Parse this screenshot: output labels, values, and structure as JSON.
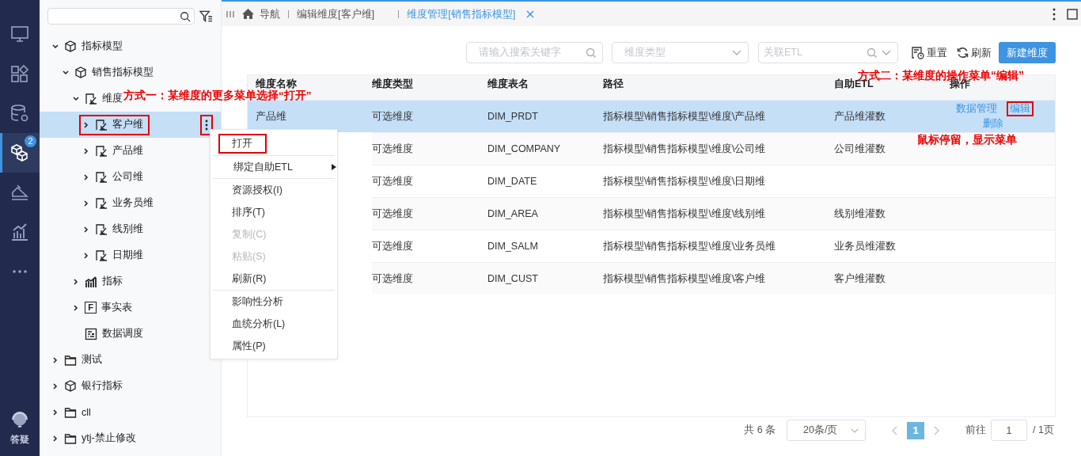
{
  "rail": {
    "items": [
      {
        "kind": "monitor",
        "selected": false
      },
      {
        "kind": "apps",
        "selected": false
      },
      {
        "kind": "database",
        "selected": false
      },
      {
        "kind": "cubes",
        "selected": true,
        "badge": "2"
      },
      {
        "kind": "ramp",
        "selected": false
      },
      {
        "kind": "bars",
        "selected": false
      },
      {
        "kind": "more",
        "selected": false
      }
    ],
    "help": {
      "label": "答疑"
    }
  },
  "sidebar": {
    "tree": [
      {
        "label": "指标模型",
        "kind": "cube",
        "expanded": true,
        "selected": false,
        "children": [
          {
            "label": "销售指标模型",
            "kind": "cube",
            "expanded": true,
            "selected": false,
            "children": [
              {
                "label": "维度",
                "kind": "dim",
                "expanded": true,
                "selected": false,
                "children": [
                  {
                    "label": "客户维",
                    "kind": "dim",
                    "expanded": false,
                    "selected": true,
                    "highlighted": true,
                    "more_button": {
                      "highlighted": true
                    }
                  },
                  {
                    "label": "产品维",
                    "kind": "dim",
                    "expanded": false,
                    "selected": false
                  },
                  {
                    "label": "公司维",
                    "kind": "dim",
                    "expanded": false,
                    "selected": false
                  },
                  {
                    "label": "业务员维",
                    "kind": "dim",
                    "expanded": false,
                    "selected": false
                  },
                  {
                    "label": "线别维",
                    "kind": "dim",
                    "expanded": false,
                    "selected": false
                  },
                  {
                    "label": "日期维",
                    "kind": "dim",
                    "expanded": false,
                    "selected": false
                  }
                ]
              },
              {
                "label": "指标",
                "kind": "metric",
                "expanded": false,
                "selected": false
              },
              {
                "label": "事实表",
                "kind": "fact",
                "icon_letter": "F",
                "expanded": false,
                "selected": false
              },
              {
                "label": "数据调度",
                "kind": "schedule",
                "selected": false
              }
            ]
          }
        ]
      },
      {
        "label": "测试",
        "kind": "folder",
        "expanded": false,
        "selected": false
      },
      {
        "label": "银行指标",
        "kind": "cube",
        "expanded": false,
        "selected": false
      },
      {
        "label": "cll",
        "kind": "folder",
        "expanded": false,
        "selected": false
      },
      {
        "label": "ytj-禁止修改",
        "kind": "folder",
        "expanded": false,
        "selected": false
      }
    ]
  },
  "context_menu": {
    "items": [
      {
        "label": "打开",
        "disabled": false,
        "highlighted": true,
        "divider_after": true
      },
      {
        "label": "绑定自助ETL",
        "disabled": false,
        "submenu": true,
        "divider_after": true
      },
      {
        "label": "资源授权(I)",
        "disabled": false
      },
      {
        "label": "排序(T)",
        "disabled": false
      },
      {
        "label": "复制(C)",
        "disabled": true
      },
      {
        "label": "粘贴(S)",
        "disabled": true
      },
      {
        "label": "刷新(R)",
        "disabled": false,
        "divider_after": true
      },
      {
        "label": "影响性分析",
        "disabled": false
      },
      {
        "label": "血统分析(L)",
        "disabled": false
      },
      {
        "label": "属性(P)",
        "disabled": false
      }
    ]
  },
  "tabs": [
    {
      "label": "导航",
      "kind": "home",
      "selected": false
    },
    {
      "label": "编辑维度[客户维]",
      "kind": "page",
      "selected": false
    },
    {
      "label": "维度管理[销售指标模型]",
      "kind": "page",
      "selected": true,
      "closable": true
    }
  ],
  "toolbar": {
    "search": {
      "placeholder": "请输入搜索关键字"
    },
    "type_select": {
      "placeholder": "维度类型"
    },
    "etl_select": {
      "placeholder": "关联ETL"
    },
    "buttons": [
      {
        "label": "重置",
        "kind": "reset"
      },
      {
        "label": "刷新",
        "kind": "refresh"
      },
      {
        "label": "新建维度",
        "kind": "primary"
      }
    ]
  },
  "table": {
    "columns": [
      "维度名称",
      "维度类型",
      "维度表名",
      "路径",
      "自助ETL",
      "操作"
    ],
    "rows": [
      {
        "selected": true,
        "cells": [
          "产品维",
          "可选维度",
          "DIM_PRDT",
          "指标模型\\销售指标模型\\维度\\产品维",
          "产品维灌数"
        ],
        "actions": [
          {
            "label": "数据管理",
            "highlighted": false
          },
          {
            "label": "编辑",
            "highlighted": true
          },
          {
            "label": "删除",
            "highlighted": false
          }
        ]
      },
      {
        "selected": false,
        "cells": [
          "",
          "可选维度",
          "DIM_COMPANY",
          "指标模型\\销售指标模型\\维度\\公司维",
          "公司维灌数"
        ]
      },
      {
        "selected": false,
        "cells": [
          "",
          "可选维度",
          "DIM_DATE",
          "指标模型\\销售指标模型\\维度\\日期维",
          ""
        ]
      },
      {
        "selected": false,
        "cells": [
          "",
          "可选维度",
          "DIM_AREA",
          "指标模型\\销售指标模型\\维度\\线别维",
          "线别维灌数"
        ]
      },
      {
        "selected": false,
        "cells": [
          "",
          "可选维度",
          "DIM_SALM",
          "指标模型\\销售指标模型\\维度\\业务员维",
          "业务员维灌数"
        ]
      },
      {
        "selected": false,
        "cells": [
          "",
          "可选维度",
          "DIM_CUST",
          "指标模型\\销售指标模型\\维度\\客户维",
          "客户维灌数"
        ]
      }
    ]
  },
  "pagination": {
    "total": "共 6 条",
    "page_size": "20条/页",
    "pages": [
      {
        "label": "1",
        "selected": true
      }
    ],
    "goto_label": "前往",
    "goto_value": "1",
    "page_count": "/ 1页"
  },
  "annotations": [
    {
      "kind": "one",
      "text": "方式一：某维度的更多菜单选择“打开”"
    },
    {
      "kind": "two",
      "text": "方式二：某维度的操作菜单“编辑”"
    },
    {
      "kind": "three",
      "text": "鼠标停留，显示菜单"
    }
  ]
}
